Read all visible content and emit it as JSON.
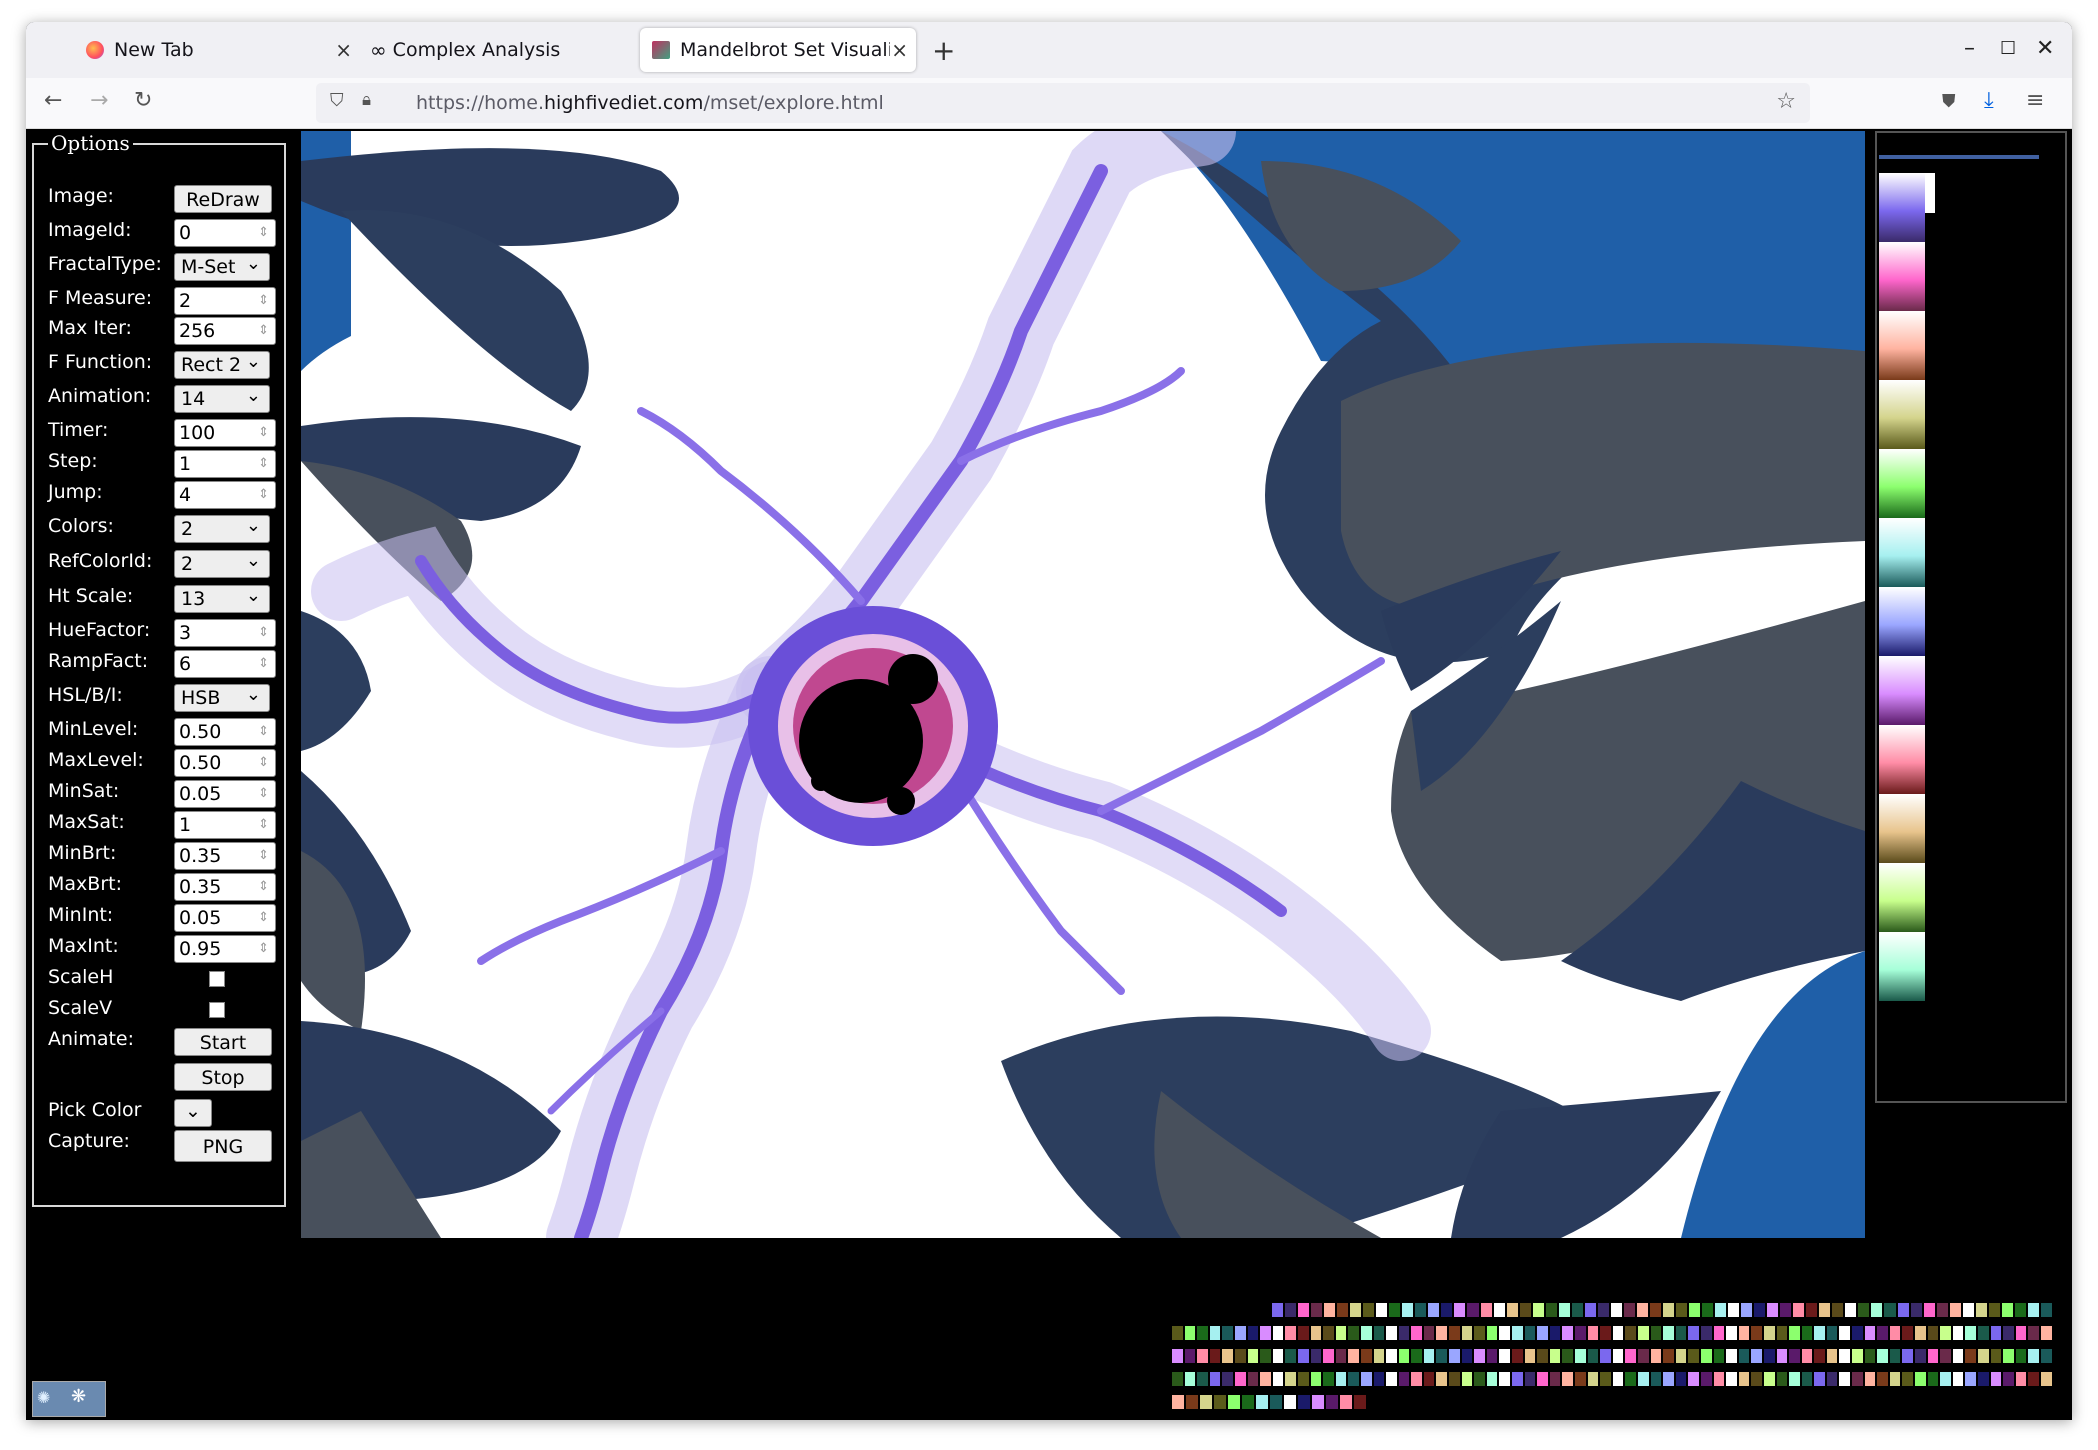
{
  "browser": {
    "tabs": [
      {
        "label": "New Tab",
        "icon": "firefox-icon"
      },
      {
        "label": "Complex Analysis",
        "icon": "infinity-icon"
      },
      {
        "label": "Mandelbrot Set Visualiza",
        "icon": "mandelbrot-favicon-icon"
      }
    ],
    "url_prefix": "https://home.",
    "url_domain": "highfivediet.com",
    "url_path": "/mset/explore.html"
  },
  "options": {
    "legend": "Options",
    "image_label": "Image:",
    "redraw": "ReDraw",
    "imageid_label": "ImageId:",
    "imageid": "0",
    "fractaltype_label": "FractalType:",
    "fractaltype": "M-Set",
    "fmeasure_label": "F Measure:",
    "fmeasure": "2",
    "maxiter_label": "Max Iter:",
    "maxiter": "256",
    "ffunction_label": "F Function:",
    "ffunction": "Rect 2",
    "animation_label": "Animation:",
    "animation": "14",
    "timer_label": "Timer:",
    "timer": "100",
    "step_label": "Step:",
    "step": "1",
    "jump_label": "Jump:",
    "jump": "4",
    "colors_label": "Colors:",
    "colors": "2",
    "refcolorid_label": "RefColorId:",
    "refcolorid": "2",
    "htscale_label": "Ht Scale:",
    "htscale": "13",
    "huefactor_label": "HueFactor:",
    "huefactor": "3",
    "rampfact_label": "RampFact:",
    "rampfact": "6",
    "hsl_label": "HSL/B/I:",
    "hsl": "HSB",
    "minlevel_label": "MinLevel:",
    "minlevel": "0.50",
    "maxlevel_label": "MaxLevel:",
    "maxlevel": "0.50",
    "minsat_label": "MinSat:",
    "minsat": "0.05",
    "maxsat_label": "MaxSat:",
    "maxsat": "1",
    "minbrt_label": "MinBrt:",
    "minbrt": "0.35",
    "maxbrt_label": "MaxBrt:",
    "maxbrt": "0.35",
    "minint_label": "MinInt:",
    "minint": "0.05",
    "maxint_label": "MaxInt:",
    "maxint": "0.95",
    "scaleh_label": "ScaleH",
    "scalev_label": "ScaleV",
    "animate_label": "Animate:",
    "start": "Start",
    "stop": "Stop",
    "pickcolor_label": "Pick Color",
    "capture_label": "Capture:",
    "png": "PNG"
  },
  "palette": {
    "bands": [
      "#7b68ee",
      "#ff66cc",
      "#ffb3a0",
      "#d4d48c",
      "#8cff6e",
      "#a6f0f0",
      "#9aa6ff",
      "#d98cff",
      "#ff8ca6",
      "#e8c48c",
      "#c8ff8c",
      "#a6ffd9"
    ],
    "dark_bands": [
      "#3a2a6a",
      "#6a2a4a",
      "#7a3a1a",
      "#5a5a1a",
      "#1a6a1a",
      "#1a5a5a",
      "#1a1a6a",
      "#5a1a6a",
      "#6a1a1a",
      "#5a4a1a",
      "#2a5a1a",
      "#1a5a4a"
    ]
  }
}
